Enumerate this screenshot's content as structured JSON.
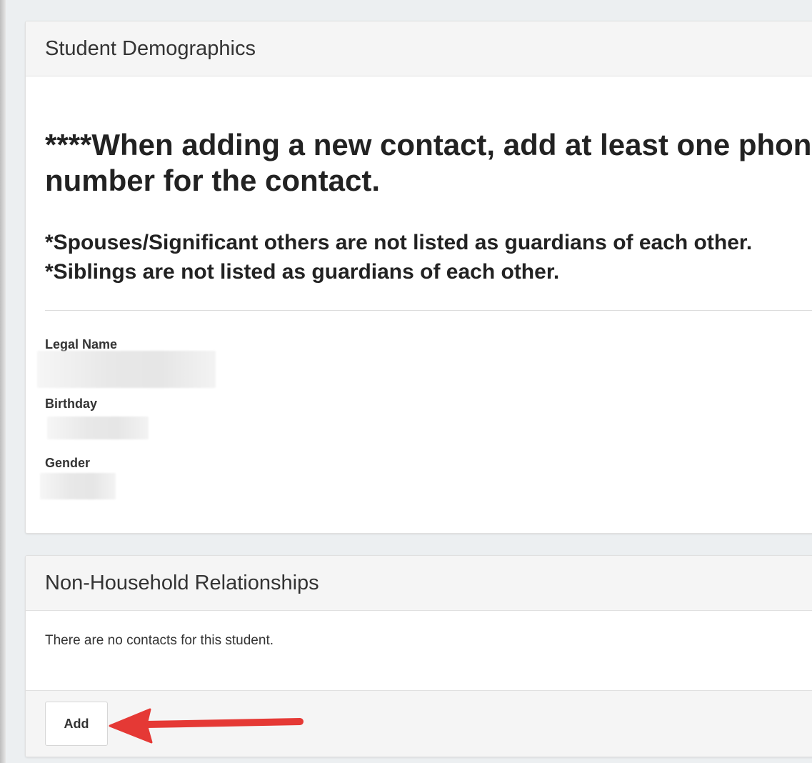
{
  "demographics": {
    "title": "Student Demographics",
    "notice_main": "****When adding a new contact, add at least one phone number for the contact.",
    "notice_sub_1": "*Spouses/Significant others are not listed as guardians of each other.",
    "notice_sub_2": "*Siblings are not listed as guardians of each other.",
    "fields": {
      "legal_name_label": "Legal Name",
      "birthday_label": "Birthday",
      "gender_label": "Gender"
    }
  },
  "relationships": {
    "title": "Non-Household Relationships",
    "empty_message": "There are no contacts for this student.",
    "add_label": "Add"
  },
  "colors": {
    "arrow": "#e53935",
    "header_bg": "#f5f5f5",
    "card_bg": "#ffffff"
  },
  "icons": {
    "arrow": "red-arrow-icon"
  }
}
